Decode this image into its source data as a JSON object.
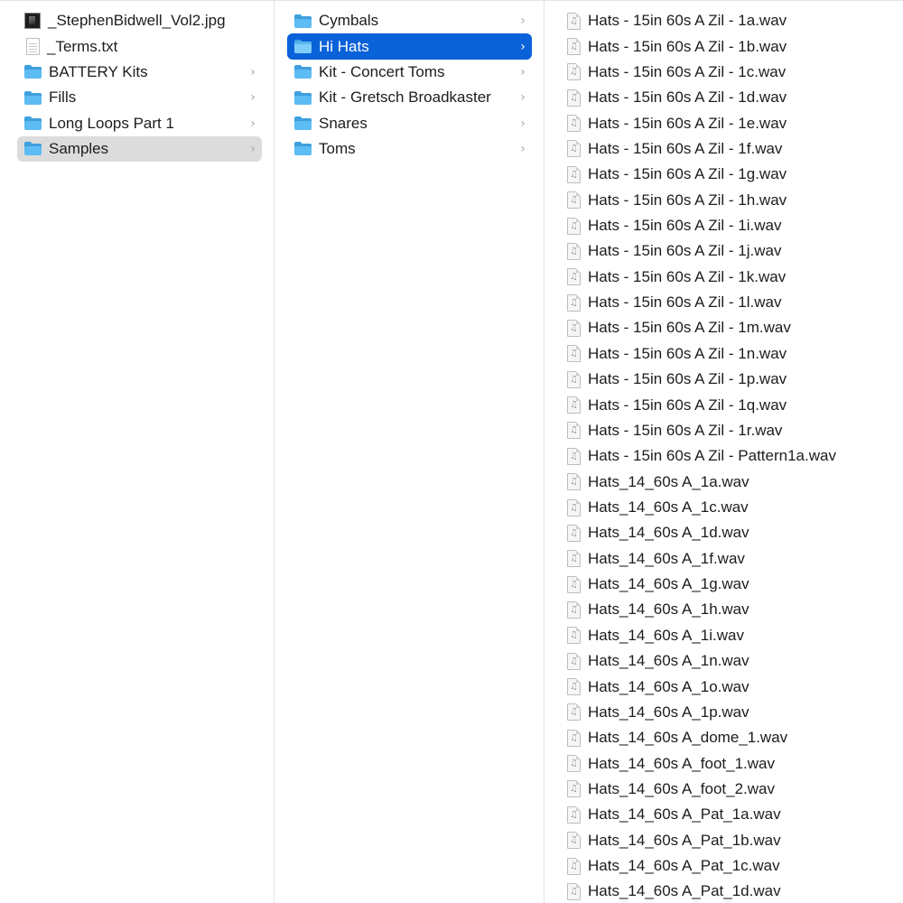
{
  "column1": {
    "items": [
      {
        "label": "_StephenBidwell_Vol2.jpg",
        "icon": "image-file-icon",
        "has_children": false
      },
      {
        "label": "_Terms.txt",
        "icon": "text-file-icon",
        "has_children": false
      },
      {
        "label": "BATTERY Kits",
        "icon": "folder-icon",
        "has_children": true
      },
      {
        "label": "Fills",
        "icon": "folder-icon",
        "has_children": true
      },
      {
        "label": "Long Loops Part 1",
        "icon": "folder-icon",
        "has_children": true
      },
      {
        "label": "Samples",
        "icon": "folder-icon",
        "has_children": true,
        "selected": "inactive"
      }
    ]
  },
  "column2": {
    "items": [
      {
        "label": "Cymbals",
        "icon": "folder-icon",
        "has_children": true
      },
      {
        "label": "Hi Hats",
        "icon": "folder-icon",
        "has_children": true,
        "selected": "active"
      },
      {
        "label": "Kit - Concert Toms",
        "icon": "folder-icon",
        "has_children": true
      },
      {
        "label": "Kit - Gretsch Broadkaster",
        "icon": "folder-icon",
        "has_children": true
      },
      {
        "label": "Snares",
        "icon": "folder-icon",
        "has_children": true
      },
      {
        "label": "Toms",
        "icon": "folder-icon",
        "has_children": true
      }
    ]
  },
  "column3": {
    "items": [
      {
        "label": "Hats - 15in 60s A Zil - 1a.wav",
        "icon": "audio-file-icon"
      },
      {
        "label": "Hats - 15in 60s A Zil - 1b.wav",
        "icon": "audio-file-icon"
      },
      {
        "label": "Hats - 15in 60s A Zil - 1c.wav",
        "icon": "audio-file-icon"
      },
      {
        "label": "Hats - 15in 60s A Zil - 1d.wav",
        "icon": "audio-file-icon"
      },
      {
        "label": "Hats - 15in 60s A Zil - 1e.wav",
        "icon": "audio-file-icon"
      },
      {
        "label": "Hats - 15in 60s A Zil - 1f.wav",
        "icon": "audio-file-icon"
      },
      {
        "label": "Hats - 15in 60s A Zil - 1g.wav",
        "icon": "audio-file-icon"
      },
      {
        "label": "Hats - 15in 60s A Zil - 1h.wav",
        "icon": "audio-file-icon"
      },
      {
        "label": "Hats - 15in 60s A Zil - 1i.wav",
        "icon": "audio-file-icon"
      },
      {
        "label": "Hats - 15in 60s A Zil - 1j.wav",
        "icon": "audio-file-icon"
      },
      {
        "label": "Hats - 15in 60s A Zil - 1k.wav",
        "icon": "audio-file-icon"
      },
      {
        "label": "Hats - 15in 60s A Zil - 1l.wav",
        "icon": "audio-file-icon"
      },
      {
        "label": "Hats - 15in 60s A Zil - 1m.wav",
        "icon": "audio-file-icon"
      },
      {
        "label": "Hats - 15in 60s A Zil - 1n.wav",
        "icon": "audio-file-icon"
      },
      {
        "label": "Hats - 15in 60s A Zil - 1p.wav",
        "icon": "audio-file-icon"
      },
      {
        "label": "Hats - 15in 60s A Zil - 1q.wav",
        "icon": "audio-file-icon"
      },
      {
        "label": "Hats - 15in 60s A Zil - 1r.wav",
        "icon": "audio-file-icon"
      },
      {
        "label": "Hats - 15in 60s A Zil - Pattern1a.wav",
        "icon": "audio-file-icon"
      },
      {
        "label": "Hats_14_60s A_1a.wav",
        "icon": "audio-file-icon"
      },
      {
        "label": "Hats_14_60s A_1c.wav",
        "icon": "audio-file-icon"
      },
      {
        "label": "Hats_14_60s A_1d.wav",
        "icon": "audio-file-icon"
      },
      {
        "label": "Hats_14_60s A_1f.wav",
        "icon": "audio-file-icon"
      },
      {
        "label": "Hats_14_60s A_1g.wav",
        "icon": "audio-file-icon"
      },
      {
        "label": "Hats_14_60s A_1h.wav",
        "icon": "audio-file-icon"
      },
      {
        "label": "Hats_14_60s A_1i.wav",
        "icon": "audio-file-icon"
      },
      {
        "label": "Hats_14_60s A_1n.wav",
        "icon": "audio-file-icon"
      },
      {
        "label": "Hats_14_60s A_1o.wav",
        "icon": "audio-file-icon"
      },
      {
        "label": "Hats_14_60s A_1p.wav",
        "icon": "audio-file-icon"
      },
      {
        "label": "Hats_14_60s A_dome_1.wav",
        "icon": "audio-file-icon"
      },
      {
        "label": "Hats_14_60s A_foot_1.wav",
        "icon": "audio-file-icon"
      },
      {
        "label": "Hats_14_60s A_foot_2.wav",
        "icon": "audio-file-icon"
      },
      {
        "label": "Hats_14_60s A_Pat_1a.wav",
        "icon": "audio-file-icon"
      },
      {
        "label": "Hats_14_60s A_Pat_1b.wav",
        "icon": "audio-file-icon"
      },
      {
        "label": "Hats_14_60s A_Pat_1c.wav",
        "icon": "audio-file-icon"
      },
      {
        "label": "Hats_14_60s A_Pat_1d.wav",
        "icon": "audio-file-icon"
      }
    ]
  },
  "colors": {
    "selection_active": "#0a62d8",
    "selection_inactive": "#dcdcdc",
    "folder": "#5cbcf3",
    "chevron": "#a9a9a9"
  },
  "chevron_glyph": "›"
}
